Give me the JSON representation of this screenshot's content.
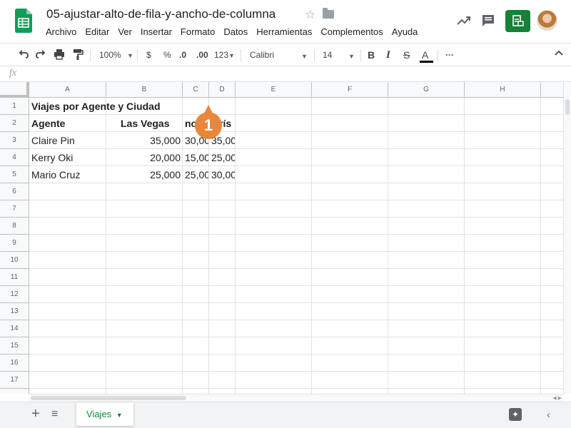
{
  "doc": {
    "title": "05-ajustar-alto-de-fila-y-ancho-de-columna"
  },
  "menu": [
    "Archivo",
    "Editar",
    "Ver",
    "Insertar",
    "Formato",
    "Datos",
    "Herramientas",
    "Complementos",
    "Ayuda"
  ],
  "toolbar": {
    "zoom": "100%",
    "currency": "$",
    "percent": "%",
    "dec_decrease": ".0",
    "dec_increase": ".00",
    "more_formats": "123",
    "font": "Calibri",
    "size": "14",
    "bold": "B",
    "italic": "I",
    "strike": "S",
    "text_color": "A",
    "more": "···"
  },
  "formula": {
    "fx": "fx"
  },
  "columns": [
    "A",
    "B",
    "C",
    "D",
    "E",
    "F",
    "G",
    "H"
  ],
  "rows": [
    "1",
    "2",
    "3",
    "4",
    "5",
    "6",
    "7",
    "8",
    "9",
    "10",
    "11",
    "12",
    "13",
    "14",
    "15",
    "16",
    "17"
  ],
  "cells": {
    "a1": "Viajes por Agente y Ciudad",
    "a2": "Agente",
    "b2": "Las Vegas",
    "c2": "no",
    "d2": "rís",
    "a3": "Claire Pin",
    "b3": "35,000",
    "c3": "30,00",
    "d3": "35,00",
    "a4": "Kerry Oki",
    "b4": "20,000",
    "c4": "15,00",
    "d4": "25,00",
    "a5": "Mario Cruz",
    "b5": "25,000",
    "c5": "25,00",
    "d5": "30,00"
  },
  "sheet": {
    "tab": "Viajes"
  },
  "callout": {
    "number": "1"
  },
  "colors": {
    "brand": "#188038",
    "callout": "#e8873a"
  }
}
